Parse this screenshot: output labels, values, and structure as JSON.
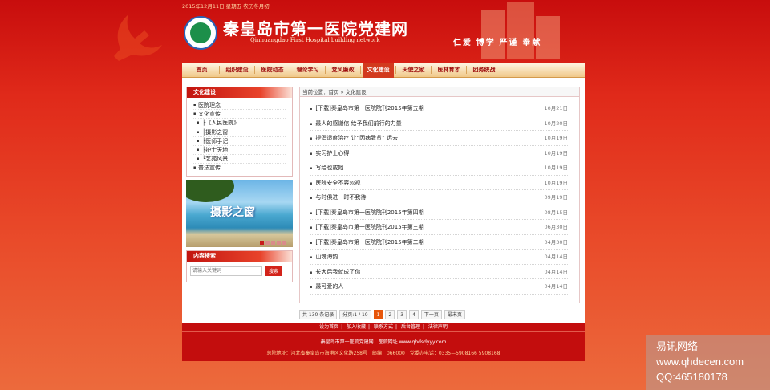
{
  "header": {
    "date": "2015年12月11日 星期五 农历冬月初一",
    "title": "秦皇岛市第一医院党建网",
    "subtitle": "Qinhuangdao First Hospital building network",
    "slogan": "仁爱 博学 严谨 奉献"
  },
  "nav": [
    "首页",
    "组织建设",
    "医院动态",
    "理论学习",
    "党风廉政",
    "文化建设",
    "天使之家",
    "医林育才",
    "团务统战"
  ],
  "nav_active_index": 5,
  "sidebar": {
    "heading": "文化建设",
    "items": [
      {
        "label": "医院理念",
        "sub": false
      },
      {
        "label": "文化宣传",
        "sub": false
      },
      {
        "label": "├《人民医院》",
        "sub": true
      },
      {
        "label": "├摄影之窗",
        "sub": true
      },
      {
        "label": "├医师手记",
        "sub": true
      },
      {
        "label": "├护士天地",
        "sub": true
      },
      {
        "label": "└艺苑风景",
        "sub": true
      },
      {
        "label": "普法宣传",
        "sub": false
      }
    ],
    "banner_text": "摄影之窗",
    "search_heading": "内容搜索",
    "search_placeholder": "请输入关键词",
    "search_button": "搜索"
  },
  "breadcrumb": "当前位置：首页 » 文化建设",
  "articles": [
    {
      "title": "[下载]秦皇岛市第一医院院刊2015年第五期",
      "date": "10月21日"
    },
    {
      "title": "最人的感谢信 给予我们前行的力量",
      "date": "10月20日"
    },
    {
      "title": "提倡适度治疗 让“因病致贫” 远去",
      "date": "10月19日"
    },
    {
      "title": "实习护士心得",
      "date": "10月19日"
    },
    {
      "title": "写给也或她",
      "date": "10月19日"
    },
    {
      "title": "医院安全不容忽视",
      "date": "10月19日"
    },
    {
      "title": "与时俱进　时不我待",
      "date": "09月19日"
    },
    {
      "title": "[下载]秦皇岛市第一医院院刊2015年第四期",
      "date": "08月15日"
    },
    {
      "title": "[下载]秦皇岛市第一医院院刊2015年第三期",
      "date": "06月30日"
    },
    {
      "title": "[下载]秦皇岛市第一医院院刊2015年第二期",
      "date": "04月30日"
    },
    {
      "title": "山魂海韵",
      "date": "04月14日"
    },
    {
      "title": "长大后我就成了你",
      "date": "04月14日"
    },
    {
      "title": "最可爱的人",
      "date": "04月14日"
    }
  ],
  "pager": {
    "total": "共 130 条记录",
    "pageinfo": "分页:1 / 10",
    "pages": [
      "1",
      "2",
      "3",
      "4"
    ],
    "current": "1",
    "next": "下一页",
    "last": "最末页"
  },
  "footer": {
    "links": [
      "设为首页",
      "加入收藏",
      "联系方式",
      "后台管理",
      "法律声明"
    ],
    "line1": "秦皇岛市第一医院党建网　医院网址 www.qhdsdyyy.com",
    "line2": "总院地址：河北省秦皇岛市海港区文化路258号　邮编：066000　党委办电话：0335—5908166 5908168"
  },
  "watermark": [
    "易讯网络",
    "www.qhdecen.com",
    "QQ:465180178"
  ]
}
